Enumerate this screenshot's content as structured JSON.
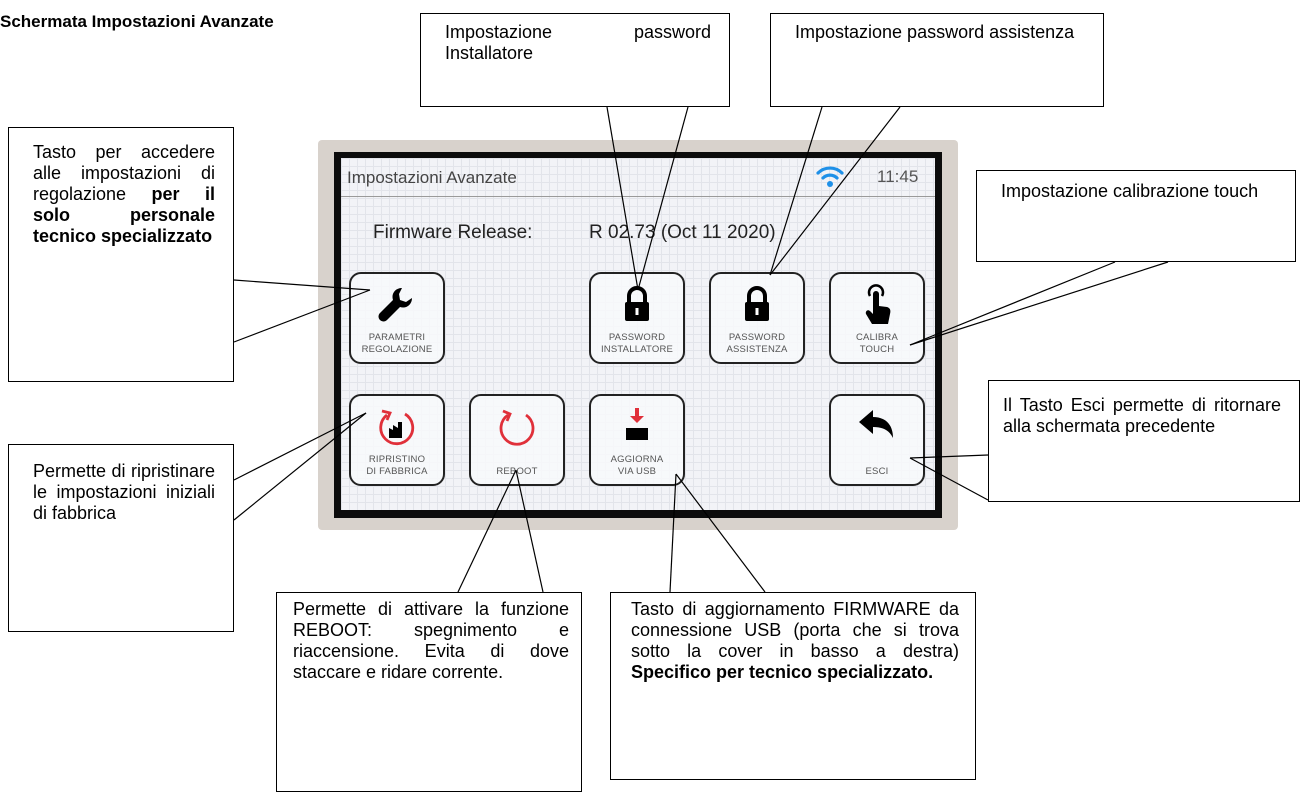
{
  "page_title": "Schermata Impostazioni Avanzate",
  "device": {
    "screen_title": "Impostazioni Avanzate",
    "clock": "11:45",
    "firmware_label": "Firmware Release:",
    "firmware_value": "R 02.73 (Oct 11 2020)",
    "buttons": [
      {
        "line1": "PARAMETRI",
        "line2": "REGOLAZIONE",
        "icon": "wrench-icon"
      },
      {
        "line1": "PASSWORD",
        "line2": "INSTALLATORE",
        "icon": "lock-icon"
      },
      {
        "line1": "PASSWORD",
        "line2": "ASSISTENZA",
        "icon": "lock-icon"
      },
      {
        "line1": "CALIBRA",
        "line2": "TOUCH",
        "icon": "touch-hand-icon"
      },
      {
        "line1": "RIPRISTINO",
        "line2": "DI FABBRICA",
        "icon": "factory-reset-icon"
      },
      {
        "line1": "REBOOT",
        "line2": "",
        "icon": "reboot-icon"
      },
      {
        "line1": "AGGIORNA",
        "line2": "VIA USB",
        "icon": "usb-update-icon"
      },
      {
        "line1": "ESCI",
        "line2": "",
        "icon": "back-arrow-icon"
      }
    ],
    "colors": {
      "accent_red": "#e0303a",
      "wifi_blue": "#1e90e8",
      "icon_black": "#000000"
    }
  },
  "callouts": {
    "password_installatore": "Impostazione password Installatore",
    "password_assistenza": "Impostazione password assistenza",
    "parametri": {
      "text": "Tasto per accedere alle impostazioni di regolazione",
      "bold": "per il solo personale tecnico specializzato"
    },
    "calibrazione": "Impostazione calibrazione touch",
    "esci": "Il Tasto Esci permette di ritornare alla schermata precedente",
    "ripristino": "Permette di ripristinare le impostazioni iniziali di fabbrica",
    "reboot": "Permette di attivare la funzione REBOOT: spegnimento e riaccensione. Evita di dove staccare e ridare corrente.",
    "aggiorna": {
      "text": "Tasto di aggiornamento FIRMWARE da connessione USB (porta che si trova sotto la cover in basso a destra)",
      "bold": "Specifico per tecnico specializzato."
    }
  }
}
